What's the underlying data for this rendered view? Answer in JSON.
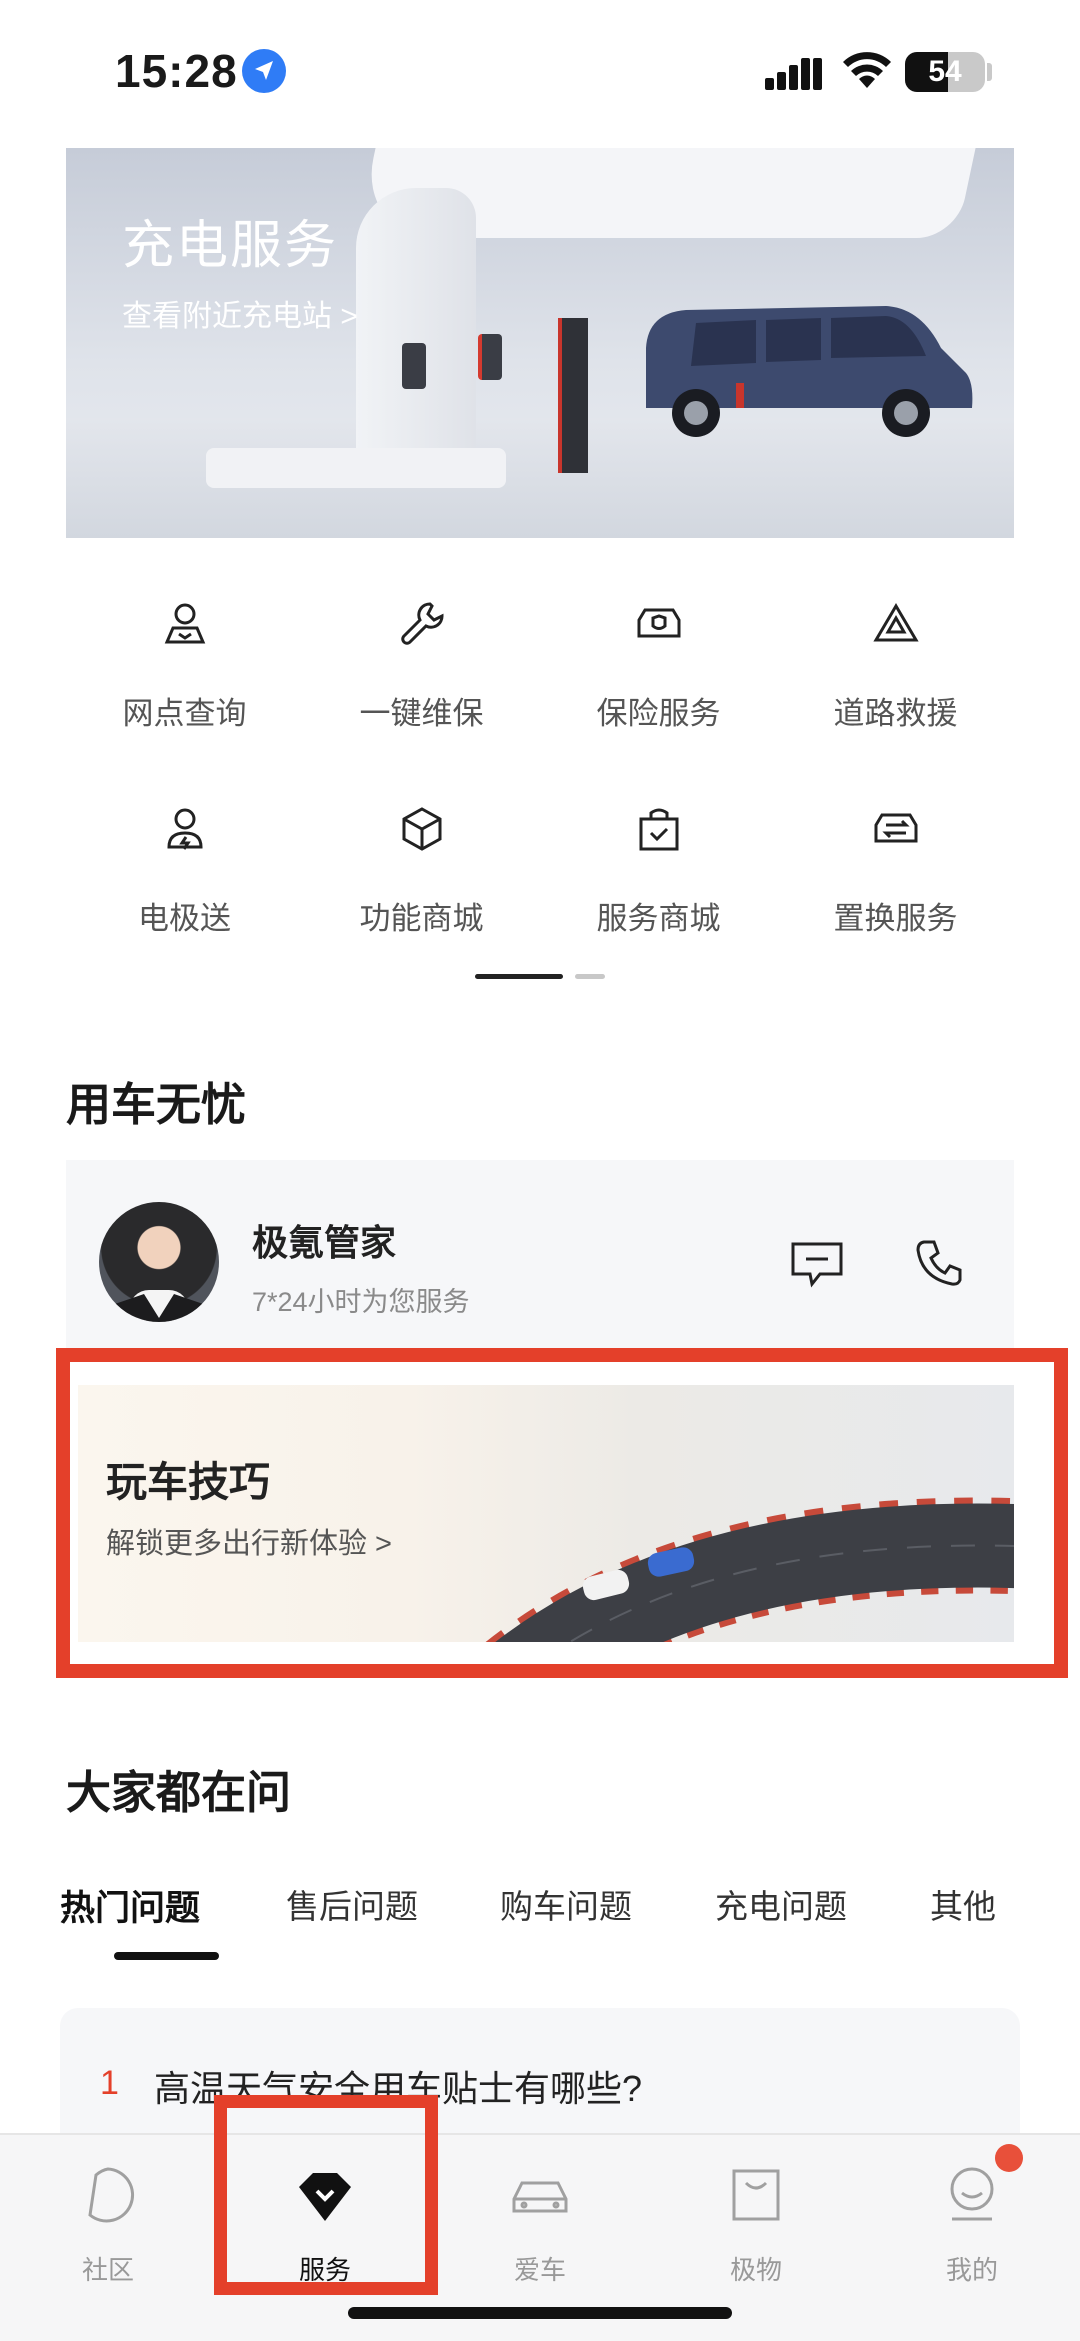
{
  "status_bar": {
    "time": "15:28",
    "battery": "54",
    "battery_level": 54
  },
  "charge_banner": {
    "title": "充电服务",
    "subtitle": "查看附近充电站 >"
  },
  "services": [
    {
      "label": "网点查询",
      "icon": "location-person-icon"
    },
    {
      "label": "一键维保",
      "icon": "wrench-icon"
    },
    {
      "label": "保险服务",
      "icon": "car-shield-icon"
    },
    {
      "label": "道路救援",
      "icon": "warning-triangle-icon"
    },
    {
      "label": "电极送",
      "icon": "courier-icon"
    },
    {
      "label": "功能商城",
      "icon": "cube-icon"
    },
    {
      "label": "服务商城",
      "icon": "shopping-bag-icon"
    },
    {
      "label": "置换服务",
      "icon": "car-swap-icon"
    }
  ],
  "worry_free": {
    "title": "用车无忧",
    "butler": {
      "name": "极氪管家",
      "subtitle": "7*24小时为您服务"
    }
  },
  "tips_banner": {
    "title": "玩车技巧",
    "subtitle": "解锁更多出行新体验 >"
  },
  "faq": {
    "title": "大家都在问",
    "tabs": [
      "热门问题",
      "售后问题",
      "购车问题",
      "充电问题",
      "其他"
    ],
    "active_tab": "热门问题",
    "items": [
      {
        "num": "1",
        "text": "高温天气安全用车贴士有哪些?"
      }
    ]
  },
  "bottom_nav": [
    {
      "label": "社区",
      "icon": "community-icon"
    },
    {
      "label": "服务",
      "icon": "service-icon",
      "active": true
    },
    {
      "label": "爱车",
      "icon": "car-icon"
    },
    {
      "label": "极物",
      "icon": "bag-icon"
    },
    {
      "label": "我的",
      "icon": "profile-icon",
      "badge": true
    }
  ],
  "colors": {
    "accent": "#e4402a",
    "location": "#2f7cf6",
    "text": "#1a1a1a",
    "muted": "#8a8a8a"
  }
}
